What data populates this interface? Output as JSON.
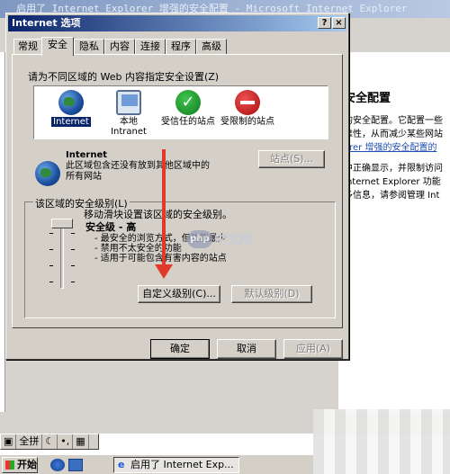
{
  "background_window": {
    "title": "启用了 Internet Explorer 增强的安全配置 - Microsoft Internet Explorer",
    "page_heading": "安全配置",
    "page_lines": [
      "的安全配置。它配置一些",
      "靠性，从而减少某些网站",
      "orer 增强的安全配置的",
      "中正确显示，并限制访问",
      "Internet Explorer 功能",
      "多信息，请参阅管理 Int"
    ]
  },
  "dialog": {
    "title": "Internet 选项",
    "titlebar_buttons": [
      "?",
      "×"
    ],
    "tabs": [
      "常规",
      "安全",
      "隐私",
      "内容",
      "连接",
      "程序",
      "高级"
    ],
    "active_tab": "安全",
    "zones_prompt": "请为不同区域的 Web 内容指定安全设置(Z)",
    "zones": [
      {
        "name": "Internet",
        "icon": "globe-icon",
        "selected": true
      },
      {
        "name": "本地 Intranet",
        "icon": "computer-icon",
        "selected": false
      },
      {
        "name": "受信任的站点",
        "icon": "checkmark-icon",
        "selected": false
      },
      {
        "name": "受限制的站点",
        "icon": "no-entry-icon",
        "selected": false
      }
    ],
    "zone_info": {
      "title": "Internet",
      "description": "此区域包含还没有放到其他区域中的所有网站",
      "sites_button": "站点(S)..."
    },
    "security_level": {
      "group_label": "该区域的安全级别(L)",
      "description": "移动滑块设置该区域的安全级别。",
      "level_title": "安全级 - 高",
      "items": [
        "- 最安全的浏览方式，但功能最少",
        "- 禁用不太安全的功能",
        "- 适用于可能包含有害内容的站点"
      ],
      "slider_level_fraction": 1.0,
      "custom_button": "自定义级别(C)...",
      "default_button": "默认级别(D)"
    },
    "buttons": {
      "ok": "确定",
      "cancel": "取消",
      "apply": "应用(A)"
    }
  },
  "watermark": {
    "badge": "php",
    "text": "中文网"
  },
  "ime_bar": [
    "全拼",
    "☾",
    "•,"
  ],
  "taskbar": {
    "start": "开始",
    "task_item": "启用了 Internet Exp..."
  },
  "colors": {
    "title_bar": "#0a246a",
    "annotation_arrow": "#e23a2a",
    "dialog_face": "#d4d0c8"
  }
}
